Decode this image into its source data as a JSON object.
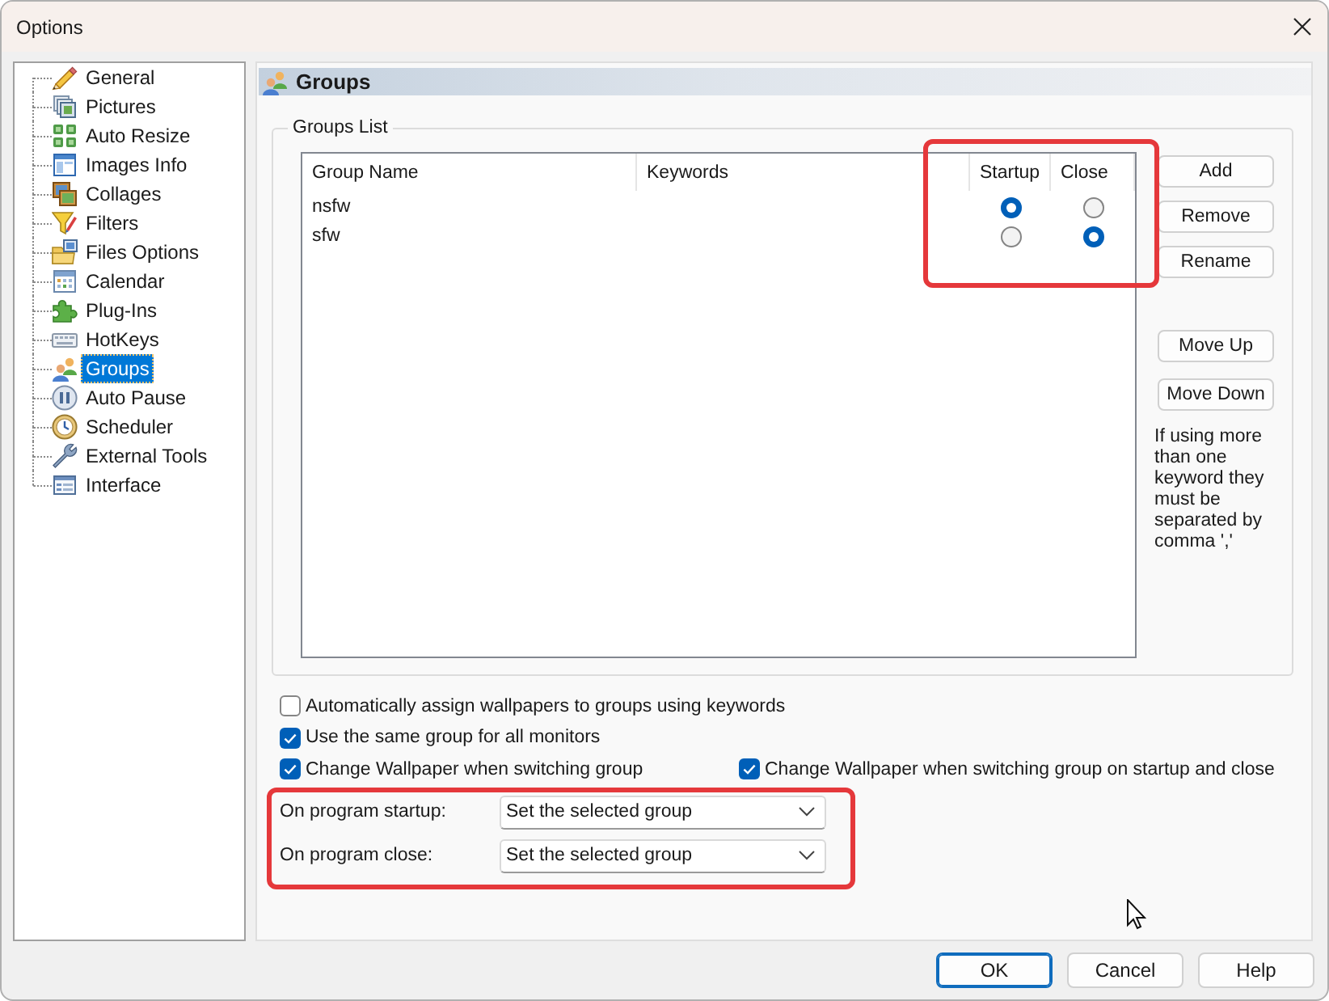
{
  "window": {
    "title": "Options"
  },
  "sidebar": {
    "items": [
      {
        "label": "General",
        "selected": false
      },
      {
        "label": "Pictures",
        "selected": false
      },
      {
        "label": "Auto Resize",
        "selected": false
      },
      {
        "label": "Images Info",
        "selected": false
      },
      {
        "label": "Collages",
        "selected": false
      },
      {
        "label": "Filters",
        "selected": false
      },
      {
        "label": "Files Options",
        "selected": false
      },
      {
        "label": "Calendar",
        "selected": false
      },
      {
        "label": "Plug-Ins",
        "selected": false
      },
      {
        "label": "HotKeys",
        "selected": false
      },
      {
        "label": "Groups",
        "selected": true
      },
      {
        "label": "Auto Pause",
        "selected": false
      },
      {
        "label": "Scheduler",
        "selected": false
      },
      {
        "label": "External Tools",
        "selected": false
      },
      {
        "label": "Interface",
        "selected": false
      }
    ]
  },
  "panel": {
    "title": "Groups",
    "groups_list": {
      "legend": "Groups List",
      "columns": [
        "Group Name",
        "Keywords",
        "Startup",
        "Close"
      ],
      "rows": [
        {
          "name": "nsfw",
          "startup_selected": true,
          "close_selected": false
        },
        {
          "name": "sfw",
          "startup_selected": false,
          "close_selected": true
        }
      ],
      "buttons": [
        "Add",
        "Remove",
        "Rename"
      ],
      "move_buttons": [
        "Move Up",
        "Move Down"
      ],
      "hint": "If using more than one keyword they must be separated by comma ','"
    },
    "option_rows": [
      [
        {
          "label": "Automatically assign wallpapers to groups using keywords",
          "checked": false
        }
      ],
      [
        {
          "label": "Use the same group for all monitors",
          "checked": true
        }
      ],
      [
        {
          "label": "Change Wallpaper when switching group",
          "checked": true
        },
        {
          "label": "Change Wallpaper when switching group on startup and close",
          "checked": true
        }
      ]
    ],
    "dropdowns": [
      {
        "label": "On program startup:",
        "value": "Set the selected group"
      },
      {
        "label": "On program close:",
        "value": "Set the selected group"
      }
    ]
  },
  "footer_buttons": [
    {
      "label": "OK",
      "default": true
    },
    {
      "label": "Cancel",
      "default": false
    },
    {
      "label": "Help",
      "default": false
    }
  ]
}
